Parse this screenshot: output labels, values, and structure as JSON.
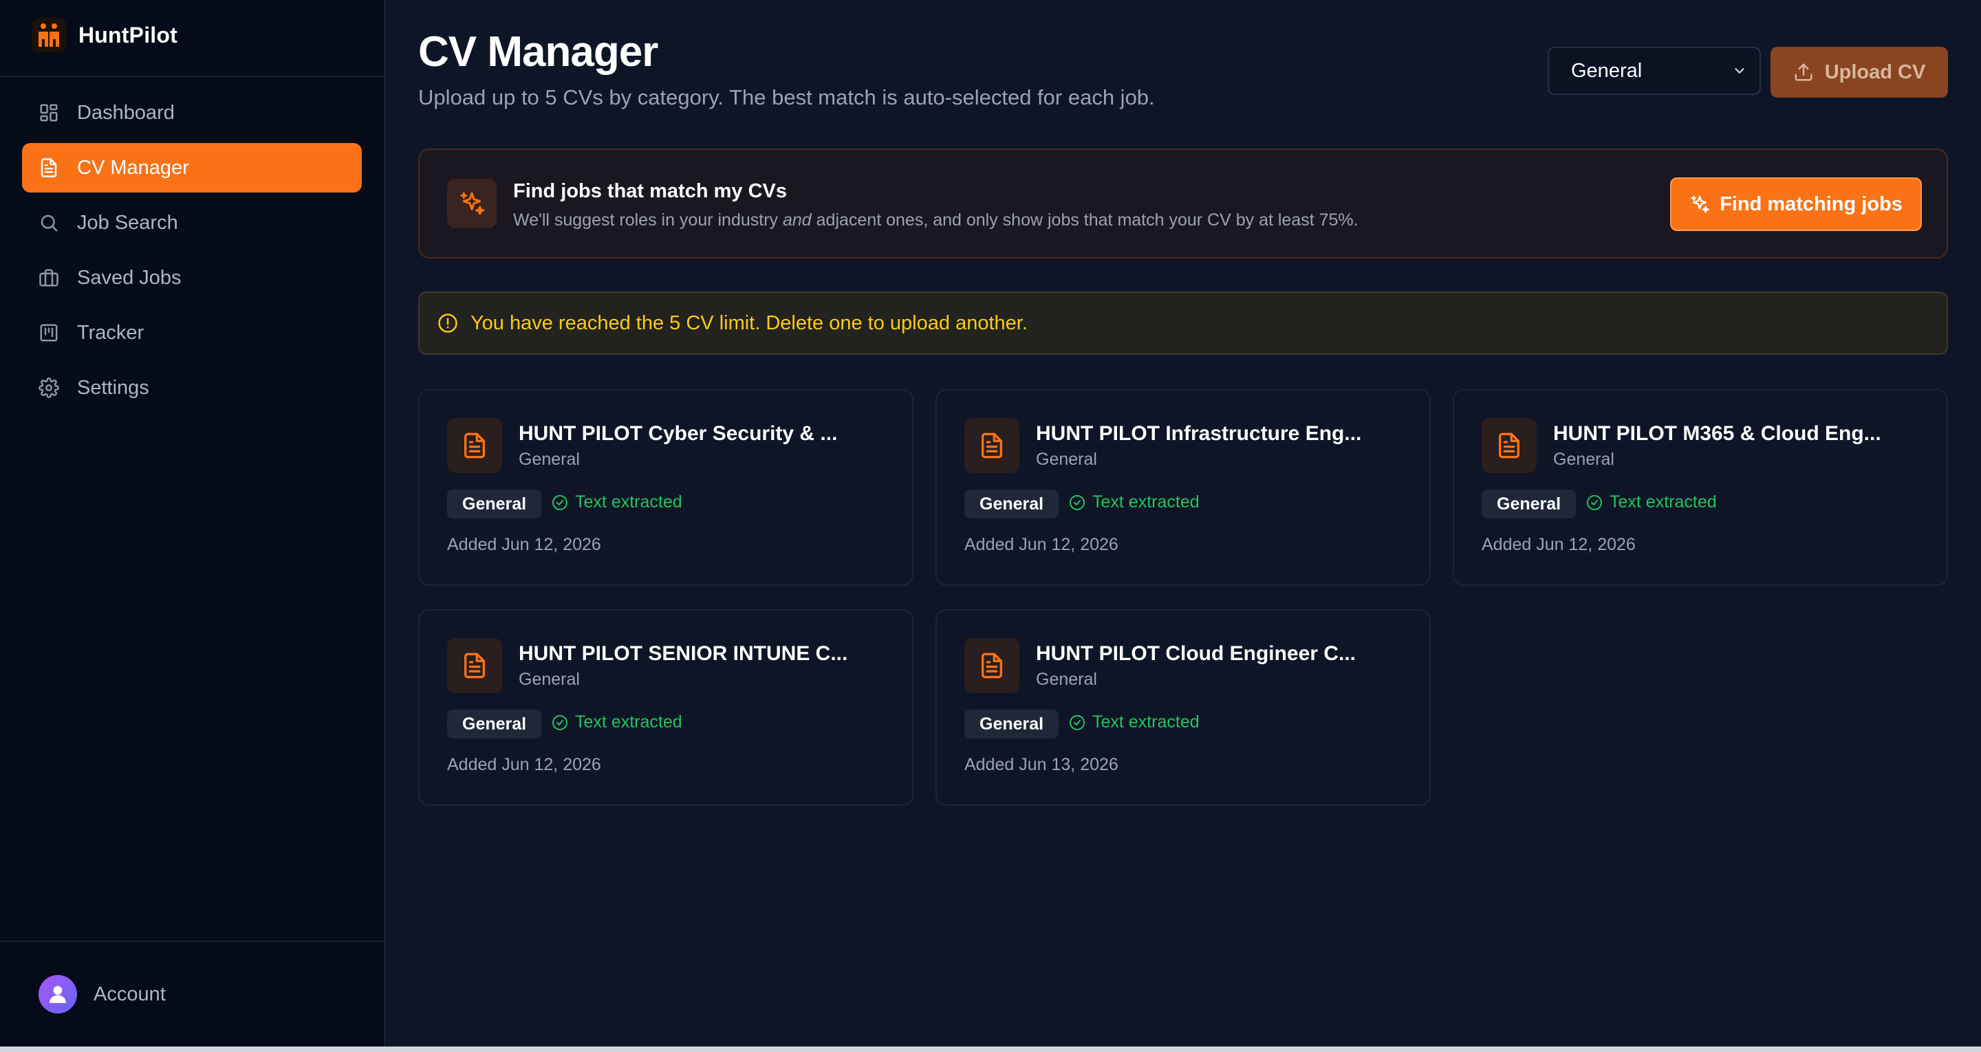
{
  "app": {
    "name": "HuntPilot"
  },
  "sidebar": {
    "items": [
      {
        "label": "Dashboard",
        "icon": "dashboard-icon"
      },
      {
        "label": "CV Manager",
        "icon": "file-icon",
        "active": true
      },
      {
        "label": "Job Search",
        "icon": "search-icon"
      },
      {
        "label": "Saved Jobs",
        "icon": "briefcase-icon"
      },
      {
        "label": "Tracker",
        "icon": "kanban-icon"
      },
      {
        "label": "Settings",
        "icon": "gear-icon"
      }
    ],
    "account_label": "Account"
  },
  "header": {
    "title": "CV Manager",
    "subtitle": "Upload up to 5 CVs by category. The best match is auto-selected for each job.",
    "category_select": "General",
    "upload_label": "Upload CV"
  },
  "match_panel": {
    "title": "Find jobs that match my CVs",
    "desc_before": "We'll suggest roles in your industry ",
    "desc_em": "and",
    "desc_after": " adjacent ones, and only show jobs that match your CV by at least 75%.",
    "button_label": "Find matching jobs"
  },
  "alert": {
    "text": "You have reached the 5 CV limit. Delete one to upload another."
  },
  "cvs": [
    {
      "name": "HUNT PILOT Cyber Security & ...",
      "category": "General",
      "badge": "General",
      "status": "Text extracted",
      "added": "Added Jun 12, 2026"
    },
    {
      "name": "HUNT PILOT Infrastructure Eng...",
      "category": "General",
      "badge": "General",
      "status": "Text extracted",
      "added": "Added Jun 12, 2026"
    },
    {
      "name": "HUNT PILOT M365 & Cloud Eng...",
      "category": "General",
      "badge": "General",
      "status": "Text extracted",
      "added": "Added Jun 12, 2026"
    },
    {
      "name": "HUNT PILOT SENIOR INTUNE C...",
      "category": "General",
      "badge": "General",
      "status": "Text extracted",
      "added": "Added Jun 12, 2026"
    },
    {
      "name": "HUNT PILOT Cloud Engineer C...",
      "category": "General",
      "badge": "General",
      "status": "Text extracted",
      "added": "Added Jun 13, 2026"
    }
  ],
  "colors": {
    "accent": "#f97316",
    "success": "#22c55e",
    "warning": "#facc15",
    "background": "#0e1526",
    "sidebar": "#050b18"
  }
}
